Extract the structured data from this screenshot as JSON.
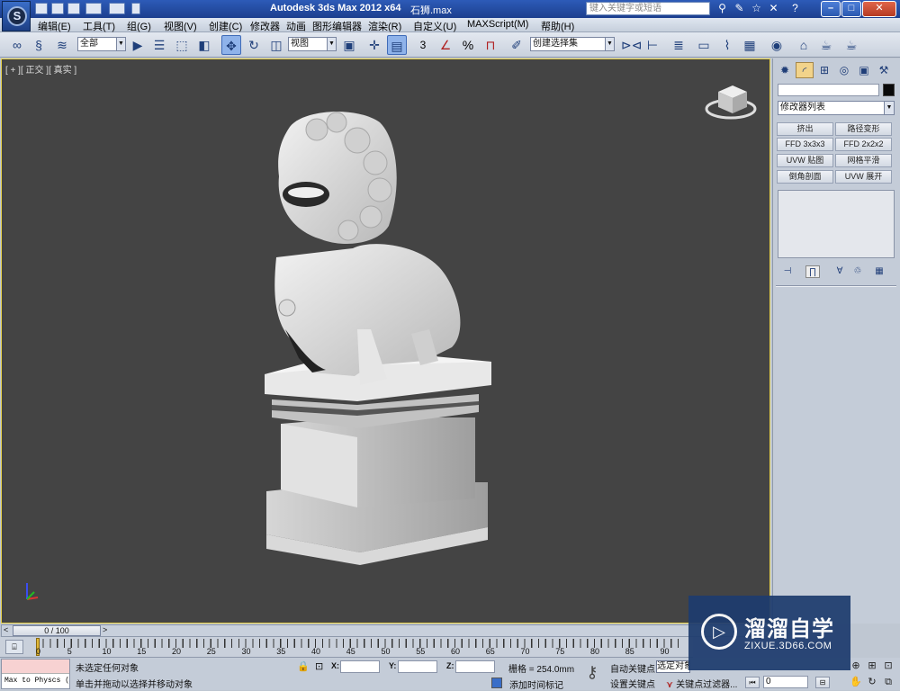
{
  "titlebar": {
    "app_title": "Autodesk 3ds Max  2012 x64",
    "file_name": "石狮.max",
    "search_placeholder": "键入关键字或短语",
    "logo_glyph": "S",
    "minimize": "–",
    "maximize": "□",
    "close": "✕",
    "icons": [
      "binoculars-icon",
      "wrench-icon",
      "star-icon",
      "help-icon"
    ]
  },
  "menu": {
    "items": [
      "编辑(E)",
      "工具(T)",
      "组(G)",
      "视图(V)",
      "创建(C)",
      "修改器",
      "动画",
      "图形编辑器",
      "渲染(R)",
      "自定义(U)",
      "MAXScript(M)",
      "帮助(H)"
    ]
  },
  "toolbar": {
    "selection_filter": "全部",
    "ref_coord": "视图",
    "named_selection": "创建选择集",
    "snap_3": "3",
    "snap_angle": "∠",
    "snap_percent": "%"
  },
  "viewport": {
    "label": "[ + ][ 正交 ][ 真实 ]",
    "background": "#444444",
    "border": "#e8d24a"
  },
  "command_panel": {
    "modifier_list": "修改器列表",
    "buttons": [
      [
        "挤出",
        "路径变形"
      ],
      [
        "FFD 3x3x3",
        "FFD 2x2x2"
      ],
      [
        "UVW 贴图",
        "网格平滑"
      ],
      [
        "倒角剖面",
        "UVW 展开"
      ]
    ]
  },
  "time_slider": {
    "frame_label": "0 / 100",
    "prev": "<",
    "next": ">"
  },
  "track": {
    "ticks": [
      "0",
      "5",
      "10",
      "15",
      "20",
      "25",
      "30",
      "35",
      "40",
      "45",
      "50",
      "55",
      "60",
      "65",
      "70",
      "75",
      "80",
      "85",
      "90"
    ]
  },
  "status": {
    "maxscript_out": "Max to Physcs (",
    "line1": "未选定任何对象",
    "line2": "单击并拖动以选择并移动对象",
    "x_label": "X:",
    "y_label": "Y:",
    "z_label": "Z:",
    "grid": "栅格 = 254.0mm",
    "add_time_tag": "添加时间标记",
    "auto_key": "自动关键点",
    "selected_set": "选定对象",
    "set_key": "设置关键点",
    "key_filters": "关键点过滤器...",
    "frame_value": "0"
  },
  "watermark": {
    "title": "溜溜自学",
    "subtitle": "ZIXUE.3D66.COM"
  }
}
